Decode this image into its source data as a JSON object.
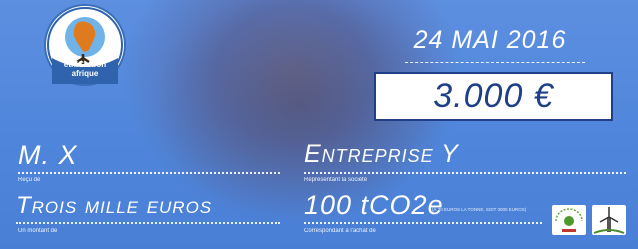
{
  "logo": {
    "line1": "ethiCarbon",
    "line2": "afrique",
    "icon": "tree-africa-icon"
  },
  "date": "24 MAI 2016",
  "amount": "3.000 €",
  "donor": {
    "value": "M. X",
    "label": "Reçu de"
  },
  "company": {
    "value": "Entreprise Y",
    "label": "Représentant la société"
  },
  "amount_words": {
    "value": "Trois mille euros",
    "label": "Un montant de"
  },
  "carbon": {
    "value": "100 tCO2e",
    "label": "Correspondant à l'achat de",
    "note": "(À 30 EUROS LA TONNE, SOIT 3000 EUROS)"
  },
  "partners": {
    "left_icon": "ecovillage-logo-icon",
    "right_icon": "windmill-logo-icon"
  },
  "colors": {
    "background": "#4f86db",
    "accent": "#1f3f86",
    "text": "#ffffff"
  }
}
